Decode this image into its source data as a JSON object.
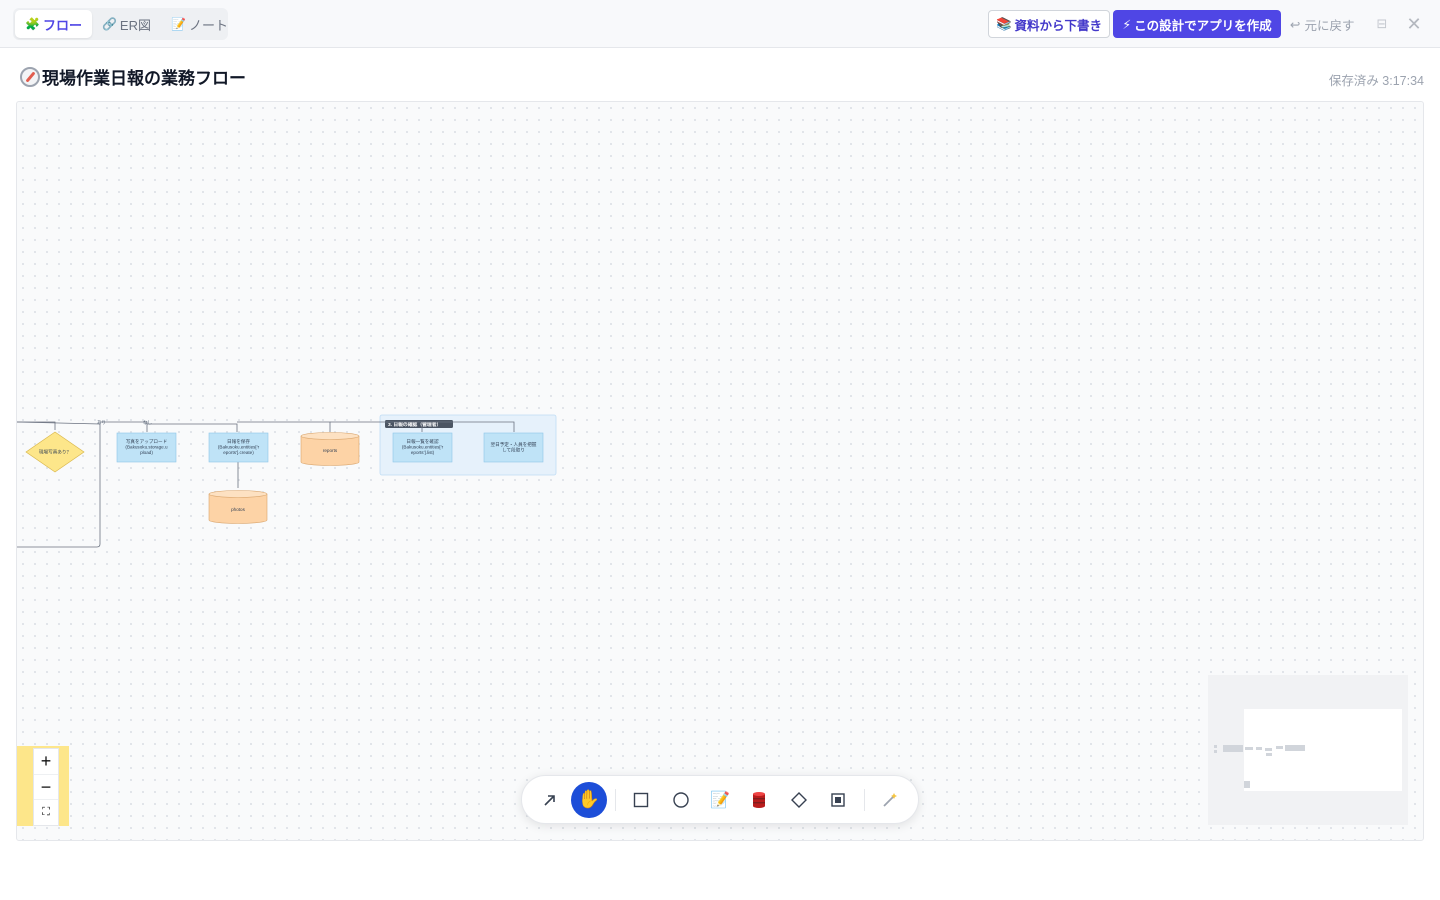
{
  "tabs": [
    {
      "label": "フロー",
      "icon": "puzzle-icon",
      "glyph": "🧩",
      "active": true
    },
    {
      "label": "ER図",
      "icon": "link-icon",
      "glyph": "🔗",
      "active": false
    },
    {
      "label": "ノート",
      "icon": "memo-icon",
      "glyph": "📝",
      "active": false
    }
  ],
  "header": {
    "draft_label": "資料から下書き",
    "draft_glyph": "📚",
    "create_label": "この設計でアプリを作成",
    "create_glyph": "⚡",
    "undo_label": "元に戻す",
    "undo_glyph": "↩",
    "minimize_glyph": "⊟",
    "close_glyph": "✕"
  },
  "page": {
    "title": "現場作業日報の業務フロー",
    "saved_status": "保存済み 3:17:34"
  },
  "diagram": {
    "decision": "現場写真あり？",
    "edge_yes": "あり",
    "edge_no": "なし",
    "process_upload": [
      "写真をアップロード",
      "(Bakusoku.storage.u",
      "pload)"
    ],
    "process_save": [
      "日報を保存",
      "(Bakusoku.entities['r",
      "eports'].create)"
    ],
    "db_reports": "reports",
    "db_photos": "photos",
    "group_label": "3. 日報の確認（管理者）",
    "process_list": [
      "日報一覧を確認",
      "(Bakusoku.entities['r",
      "eports'].list)"
    ],
    "process_plan": [
      "翌日予定・人員を把握",
      "して段取り"
    ]
  },
  "zoom": {
    "in": "+",
    "out": "−",
    "fit": "⛶"
  },
  "toolbar": {
    "tools": [
      "arrow-tool",
      "hand-tool",
      "rectangle-tool",
      "circle-tool",
      "note-tool",
      "database-tool",
      "diamond-tool",
      "group-tool",
      "magic-wand-tool"
    ]
  },
  "colors": {
    "accent": "#4f46e5",
    "active_tool": "#1d4ed8",
    "process": "#bfe3f7",
    "database": "#fdd3a6",
    "decision": "#fde68a",
    "group": "#e6f1fb"
  }
}
